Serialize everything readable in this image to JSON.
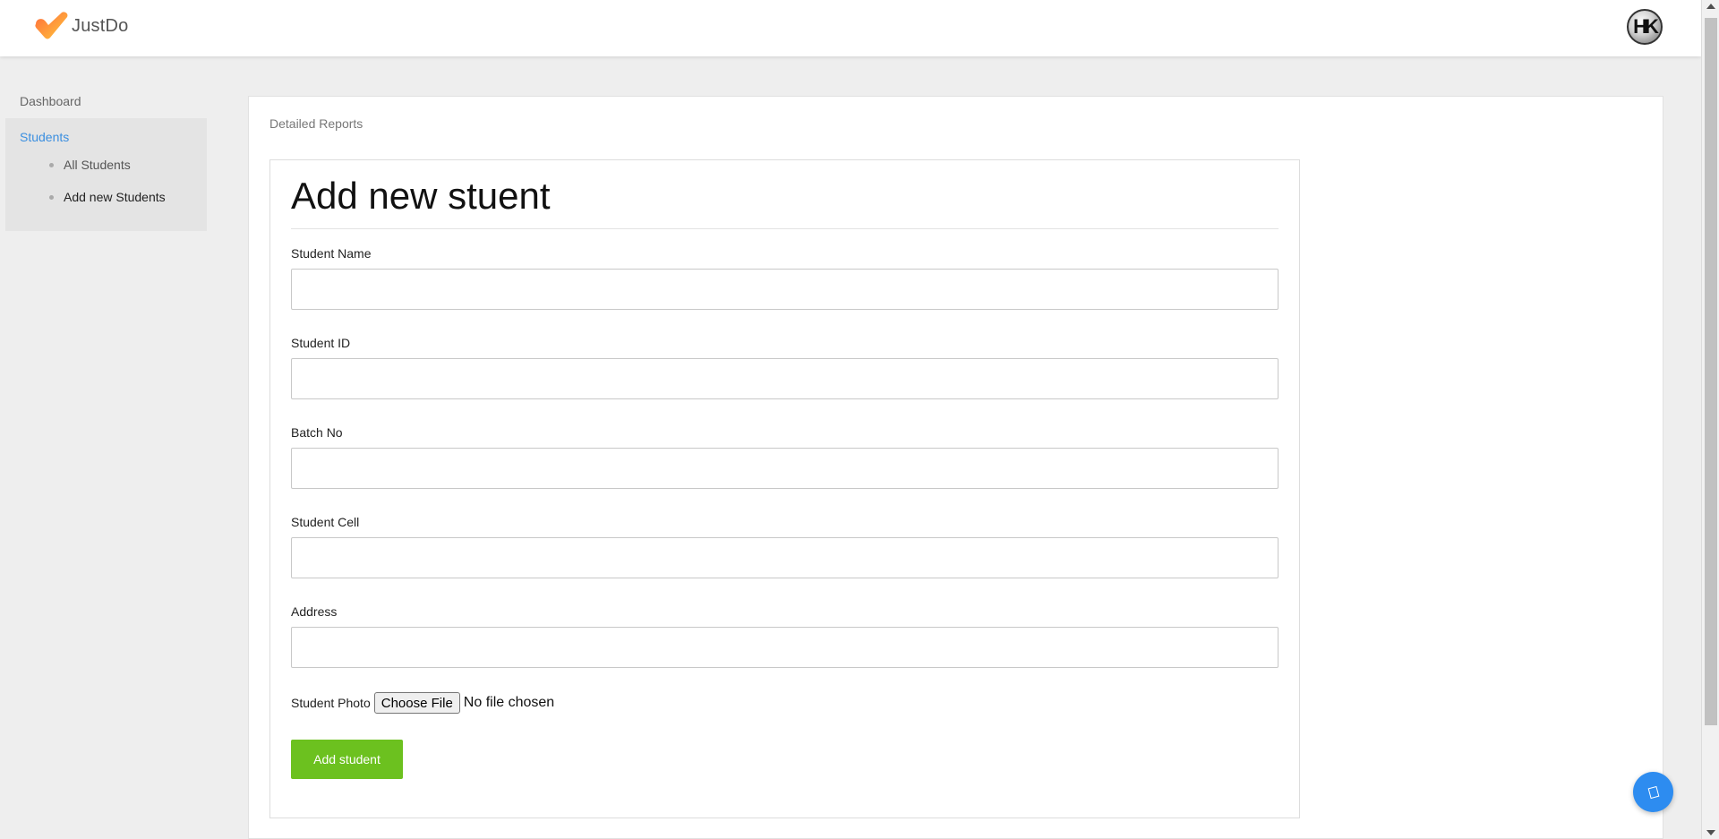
{
  "header": {
    "brand": "JustDo",
    "avatar_initials": "HK"
  },
  "sidebar": {
    "dashboard": "Dashboard",
    "students": "Students",
    "items": [
      {
        "label": "All Students"
      },
      {
        "label": "Add new Students"
      }
    ]
  },
  "main": {
    "section_title": "Detailed Reports",
    "form": {
      "heading": "Add new stuent",
      "fields": [
        {
          "label": "Student Name",
          "value": ""
        },
        {
          "label": "Student ID",
          "value": ""
        },
        {
          "label": "Batch No",
          "value": ""
        },
        {
          "label": "Student Cell",
          "value": ""
        },
        {
          "label": "Address",
          "value": ""
        }
      ],
      "photo_label": "Student Photo",
      "choose_file": "Choose File",
      "file_status": "No file chosen",
      "submit": "Add student"
    }
  },
  "colors": {
    "accent_blue": "#3b8fe0",
    "submit_green": "#6cc11f",
    "fab_blue": "#2d8cf0",
    "logo_orange": "#f5a623"
  },
  "icons": {
    "logo": "check-heart-icon",
    "fab": "tag-icon"
  }
}
